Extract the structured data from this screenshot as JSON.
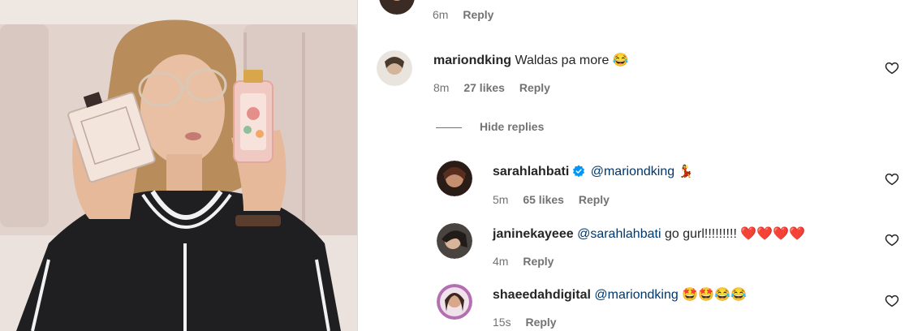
{
  "top_comment": {
    "time": "6m",
    "reply_label": "Reply"
  },
  "comments": [
    {
      "username": "mariondking",
      "text": "Waldas pa more 😂",
      "time": "8m",
      "likes": "27 likes",
      "reply_label": "Reply"
    }
  ],
  "hide_replies_label": "Hide replies",
  "replies": [
    {
      "username": "sarahlahbati",
      "verified": true,
      "mention": "@mariondking",
      "text": "💃",
      "time": "5m",
      "likes": "65 likes",
      "reply_label": "Reply"
    },
    {
      "username": "janinekayeee",
      "mention": "@sarahlahbati",
      "text": "go gurl!!!!!!!!! ❤️❤️❤️❤️",
      "time": "4m",
      "reply_label": "Reply"
    },
    {
      "username": "shaeedahdigital",
      "mention": "@mariondking",
      "text": "🤩🤩😂😂",
      "time": "15s",
      "reply_label": "Reply"
    }
  ],
  "colors": {
    "text": "#262626",
    "secondary": "#737373",
    "mention": "#00376b",
    "verified": "#0095f6"
  },
  "icons": {
    "like": "heart-outline-icon",
    "verified": "verified-badge-icon"
  }
}
